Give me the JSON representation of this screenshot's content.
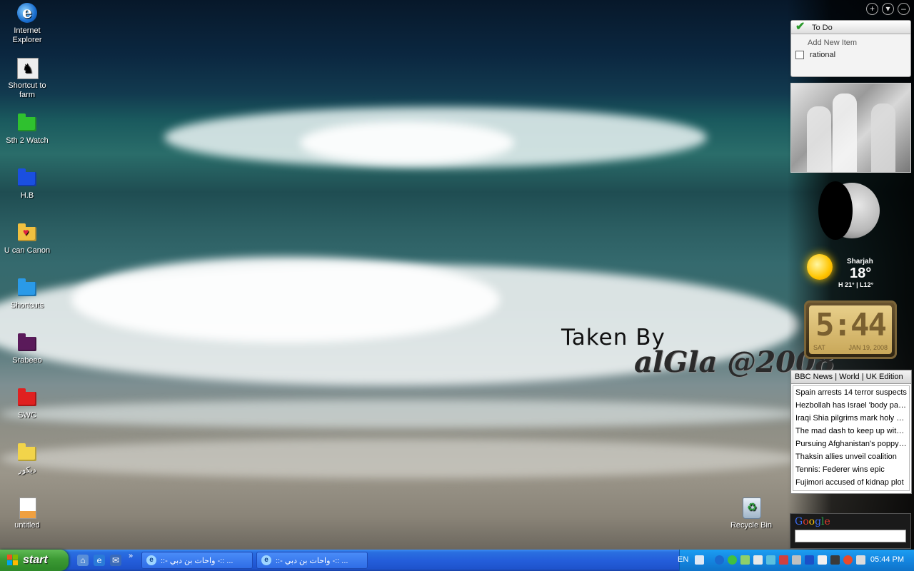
{
  "desktop": {
    "icons": [
      {
        "label_line1": "Internet",
        "label_line2": "Explorer",
        "icon": "internet-explorer-icon"
      },
      {
        "label_line1": "Shortcut to",
        "label_line2": "farm",
        "icon": "shortcut-icon"
      },
      {
        "label_line1": "Sth 2 Watch",
        "label_line2": "",
        "icon": "green-folder-icon",
        "color": "#2fc12f"
      },
      {
        "label_line1": "H.B",
        "label_line2": "",
        "icon": "blue-folder-icon",
        "color": "#1a4fe0"
      },
      {
        "label_line1": "U can Canon",
        "label_line2": "",
        "icon": "heart-folder-icon",
        "color": "#f0c040"
      },
      {
        "label_line1": "Shortcuts",
        "label_line2": "",
        "icon": "lightblue-folder-icon",
        "color": "#2a9ae8"
      },
      {
        "label_line1": "Srabeeo",
        "label_line2": "",
        "icon": "purple-folder-icon",
        "color": "#5a1a5a"
      },
      {
        "label_line1": "SWC",
        "label_line2": "",
        "icon": "red-folder-icon",
        "color": "#e02020"
      },
      {
        "label_line1": "ديكور",
        "label_line2": "",
        "icon": "yellow-folder-icon",
        "color": "#f2d44a"
      },
      {
        "label_line1": "untitled",
        "label_line2": "",
        "icon": "image-file-icon"
      }
    ],
    "recycle_bin": "Recycle Bin",
    "watermark_line1": "Taken By",
    "watermark_line2": "alGla @2008"
  },
  "sidebar": {
    "controls": [
      "+",
      "▾",
      "–"
    ],
    "todo": {
      "title": "To Do",
      "add_placeholder": "Add New Item",
      "items": [
        "rational"
      ]
    },
    "weather": {
      "city": "Sharjah",
      "temp": "18°",
      "high_low": "H 21° | L12°"
    },
    "clock": {
      "time": "5:44",
      "day": "SAT",
      "date": "JAN 19, 2008"
    },
    "news": {
      "header": "BBC News | World | UK Edition",
      "headlines": [
        "Spain arrests 14 terror suspects",
        "Hezbollah has Israel 'body parts'",
        "Iraqi Shia pilgrims mark holy day",
        "The mad dash to keep up with ...",
        "Pursuing Afghanistan's poppy ...",
        "Thaksin allies unveil coalition",
        "Tennis: Federer wins epic",
        "Fujimori accused of kidnap plot"
      ]
    },
    "google": {
      "logo_letters": [
        "G",
        "o",
        "o",
        "g",
        "l",
        "e"
      ],
      "logo_colors": [
        "#3b6df5",
        "#e33b2f",
        "#f4c20d",
        "#3b6df5",
        "#2aa24a",
        "#e33b2f"
      ]
    }
  },
  "taskbar": {
    "start_label": "start",
    "quick_launch_more": "»",
    "tasks": [
      "::- واحات بن دبي -:: ...",
      "::- واحات بن دبي -:: ..."
    ],
    "language": "EN",
    "clock": "05:44 PM"
  }
}
